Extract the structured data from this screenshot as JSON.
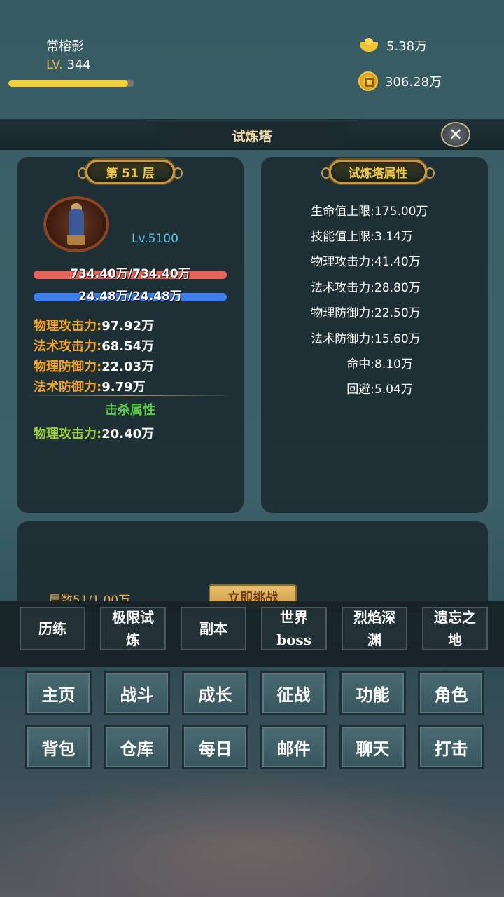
{
  "player": {
    "name": "常榕影",
    "level_tag": "LV.",
    "level": "344",
    "exp_ratio": 0.95
  },
  "currency": {
    "ingot": "5.38万",
    "coin": "306.28万"
  },
  "window": {
    "title": "试炼塔",
    "close_icon": "close-icon"
  },
  "left_panel": {
    "floor": "第 51 层",
    "monster_level": "Lv.5100",
    "hp": "734.40万/734.40万",
    "mp": "24.48万/24.48万",
    "stats": [
      {
        "k": "物理攻击力:",
        "v": "97.92万"
      },
      {
        "k": "法术攻击力:",
        "v": "68.54万"
      },
      {
        "k": "物理防御力:",
        "v": "22.03万"
      },
      {
        "k": "法术防御力:",
        "v": "9.79万"
      }
    ],
    "kill_title": "击杀属性",
    "kill_stats": [
      {
        "k": "物理攻击力:",
        "v": "20.40万"
      }
    ]
  },
  "right_panel": {
    "title": "试炼塔属性",
    "attrs": [
      {
        "k": "生命值上限:",
        "v": "175.00万"
      },
      {
        "k": "技能值上限:",
        "v": "3.14万"
      },
      {
        "k": "物理攻击力:",
        "v": "41.40万"
      },
      {
        "k": "法术攻击力:",
        "v": "28.80万"
      },
      {
        "k": "物理防御力:",
        "v": "22.50万"
      },
      {
        "k": "法术防御力:",
        "v": "15.60万"
      },
      {
        "k": "命中:",
        "v": "8.10万"
      },
      {
        "k": "回避:",
        "v": "5.04万"
      }
    ]
  },
  "bottom_panel": {
    "floor_count": "层数51/1.00万",
    "challenge_label": "立即挑战"
  },
  "tabs": [
    "历练",
    "极限试炼",
    "副本",
    "世界boss",
    "烈焰深渊",
    "遗忘之地"
  ],
  "tab_lines": [
    [
      "历练"
    ],
    [
      "极限试",
      "炼"
    ],
    [
      "副本"
    ],
    [
      "世界",
      "boss"
    ],
    [
      "烈焰深",
      "渊"
    ],
    [
      "遗忘之",
      "地"
    ]
  ],
  "nav": [
    [
      "主页",
      "战斗",
      "成长",
      "征战",
      "功能",
      "角色"
    ],
    [
      "背包",
      "仓库",
      "每日",
      "邮件",
      "聊天",
      "打击"
    ]
  ]
}
